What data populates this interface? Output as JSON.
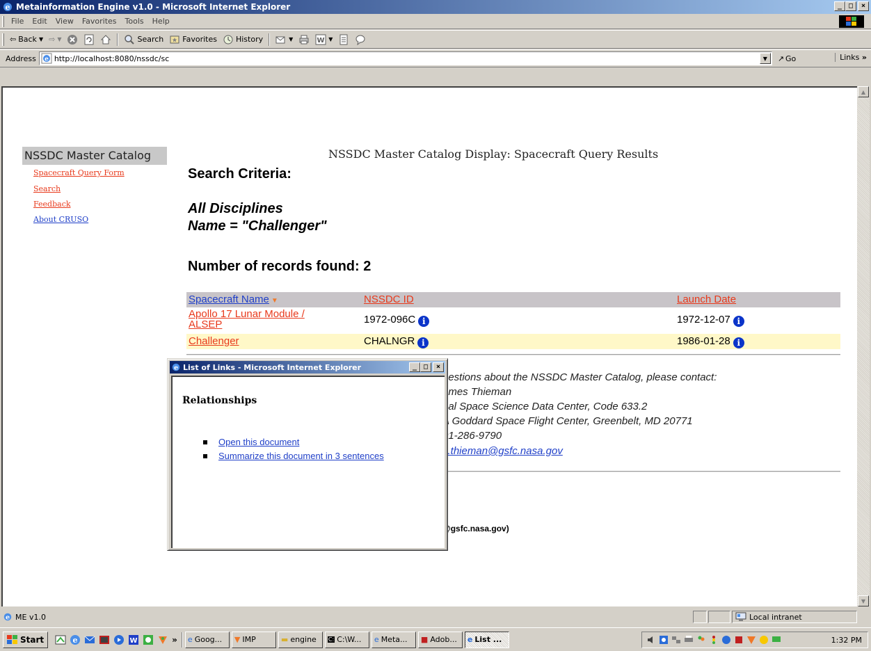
{
  "window": {
    "title": "Metainformation Engine v1.0 - Microsoft Internet Explorer",
    "min": "_",
    "max": "□",
    "close": "×"
  },
  "menu": [
    "File",
    "Edit",
    "View",
    "Favorites",
    "Tools",
    "Help"
  ],
  "toolbar": {
    "back": "Back",
    "search": "Search",
    "favorites": "Favorites",
    "history": "History"
  },
  "address": {
    "label": "Address",
    "url": "http://localhost:8080/nssdc/sc",
    "go": "Go",
    "links": "Links"
  },
  "leftnav": {
    "title": "NSSDC Master Catalog",
    "links": [
      {
        "label": "Spacecraft Query Form",
        "color": "#e8391b"
      },
      {
        "label": "Search",
        "color": "#e8391b"
      },
      {
        "label": "Feedback",
        "color": "#e8391b"
      },
      {
        "label": "About CRUSO",
        "color": "#1f3fc8"
      }
    ]
  },
  "page": {
    "title": "NSSDC Master Catalog Display: Spacecraft Query Results",
    "search_heading": "Search Criteria:",
    "criteria": [
      "All Disciplines",
      "Name = \"Challenger\""
    ],
    "count_text": "Number of records found: 2"
  },
  "results": {
    "headers": [
      "Spacecraft Name",
      "NSSDC ID",
      "Launch Date"
    ],
    "rows": [
      {
        "name": "Apollo 17 Lunar Module / ALSEP",
        "id": "1972-096C",
        "date": "1972-12-07"
      },
      {
        "name": "Challenger",
        "id": "CHALNGR",
        "date": "1986-01-28"
      }
    ]
  },
  "contact": {
    "lines": [
      "uestions about the NSSDC Master Catalog, please contact:",
      "ames Thieman",
      "nal Space Science Data Center, Code 633.2",
      "A Goddard Space Flight Center, Greenbelt, MD 20771",
      "01-286-9790"
    ],
    "email": "s.thieman@gsfc.nasa.gov",
    "footer_email": "@gsfc.nasa.gov)"
  },
  "popup": {
    "title": "List of Links - Microsoft Internet Explorer",
    "heading": "Relationships",
    "links": [
      "Open this document",
      "Summarize this document in 3 sentences"
    ]
  },
  "status": {
    "text": "ME v1.0",
    "zone": "Local intranet"
  },
  "taskbar": {
    "start": "Start",
    "chevron": "»",
    "tasks": [
      "Goog...",
      "IMP",
      "engine",
      "C:\\W...",
      "Meta...",
      "Adob...",
      "List ..."
    ],
    "active_task": 6,
    "clock": "1:32 PM"
  }
}
